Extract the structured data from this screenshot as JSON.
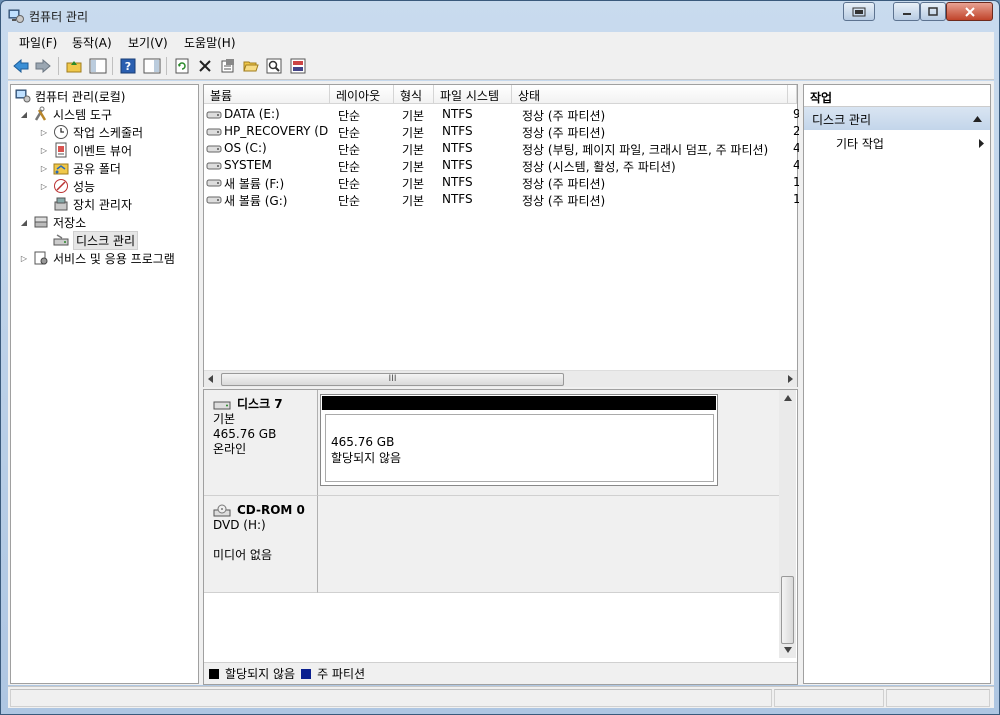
{
  "window": {
    "title": "컴퓨터 관리"
  },
  "menu": {
    "items": [
      "파일(F)",
      "동작(A)",
      "보기(V)",
      "도움말(H)"
    ]
  },
  "tree": {
    "root": "컴퓨터 관리(로컬)",
    "system_tools": "시스템 도구",
    "task_scheduler": "작업 스케줄러",
    "event_viewer": "이벤트 뷰어",
    "shared_folders": "공유 폴더",
    "performance": "성능",
    "device_manager": "장치 관리자",
    "storage": "저장소",
    "disk_management": "디스크 관리",
    "services_apps": "서비스 및 응용 프로그램"
  },
  "volumes": {
    "columns": [
      "볼륨",
      "레이아웃",
      "형식",
      "파일 시스템",
      "상태"
    ],
    "rows": [
      {
        "name": "DATA (E:)",
        "layout": "단순",
        "type": "기본",
        "fs": "NTFS",
        "status": "정상 (주 파티션)",
        "extra": "9"
      },
      {
        "name": "HP_RECOVERY (D:)",
        "layout": "단순",
        "type": "기본",
        "fs": "NTFS",
        "status": "정상 (주 파티션)",
        "extra": "2"
      },
      {
        "name": "OS (C:)",
        "layout": "단순",
        "type": "기본",
        "fs": "NTFS",
        "status": "정상 (부팅, 페이지 파일, 크래시 덤프, 주 파티션)",
        "extra": "4"
      },
      {
        "name": "SYSTEM",
        "layout": "단순",
        "type": "기본",
        "fs": "NTFS",
        "status": "정상 (시스템, 활성, 주 파티션)",
        "extra": "4"
      },
      {
        "name": "새 볼륨 (F:)",
        "layout": "단순",
        "type": "기본",
        "fs": "NTFS",
        "status": "정상 (주 파티션)",
        "extra": "1"
      },
      {
        "name": "새 볼륨 (G:)",
        "layout": "단순",
        "type": "기본",
        "fs": "NTFS",
        "status": "정상 (주 파티션)",
        "extra": "1"
      }
    ]
  },
  "disks": {
    "disk7": {
      "name": "디스크 7",
      "type": "기본",
      "size": "465.76 GB",
      "state": "온라인",
      "partition_size": "465.76 GB",
      "partition_state": "할당되지 않음"
    },
    "cdrom0": {
      "name": "CD-ROM 0",
      "drive": "DVD (H:)",
      "media": "미디어 없음"
    }
  },
  "legend": {
    "unallocated": "할당되지 않음",
    "primary": "주 파티션"
  },
  "actions": {
    "title": "작업",
    "section": "디스크 관리",
    "more": "기타 작업"
  },
  "colors": {
    "unallocated": "#000000",
    "primary": "#0a1f8f",
    "section_bg": "#c9d9ec"
  }
}
